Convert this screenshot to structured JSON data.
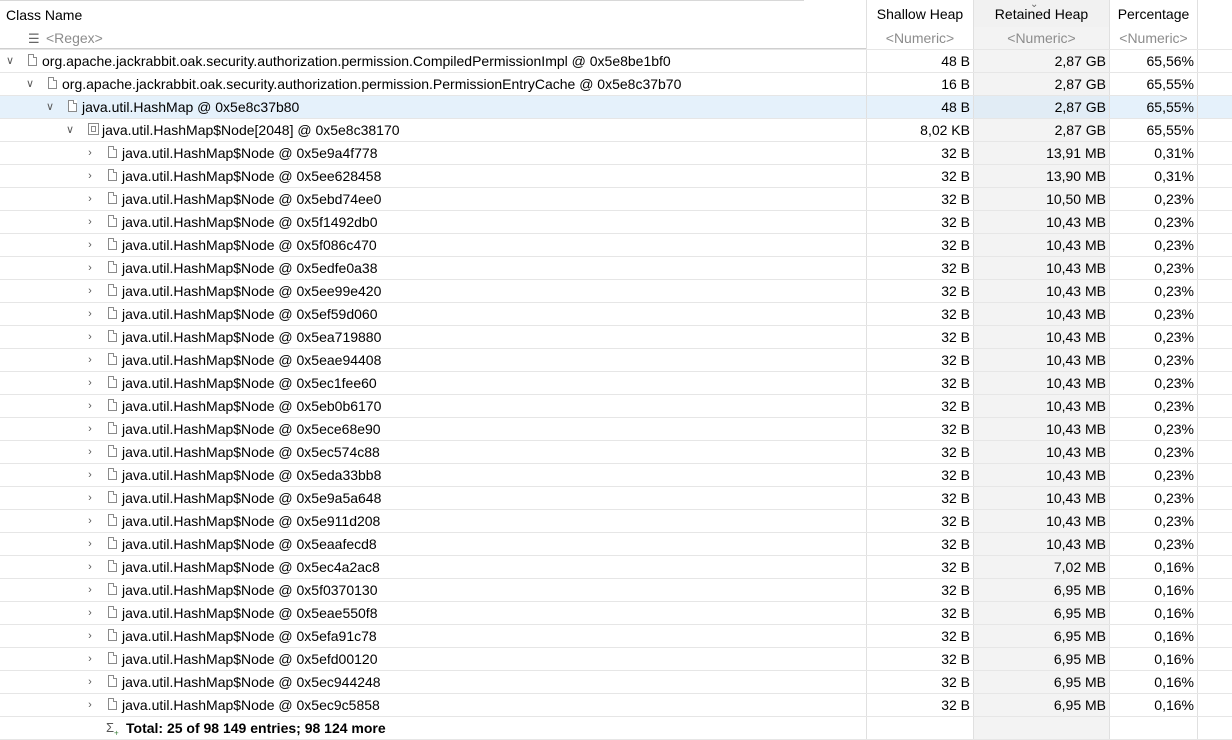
{
  "columns": {
    "name": "Class Name",
    "shallow": "Shallow Heap",
    "retained": "Retained Heap",
    "percentage": "Percentage"
  },
  "filter": {
    "name": "<Regex>",
    "shallow": "<Numeric>",
    "retained": "<Numeric>",
    "percentage": "<Numeric>"
  },
  "rows": [
    {
      "label": "org.apache.jackrabbit.oak.security.authorization.permission.CompiledPermissionImpl @ 0x5e8be1bf0",
      "shallow": "48 B",
      "retained": "2,87 GB",
      "pct": "65,56%"
    },
    {
      "label": "org.apache.jackrabbit.oak.security.authorization.permission.PermissionEntryCache @ 0x5e8c37b70",
      "shallow": "16 B",
      "retained": "2,87 GB",
      "pct": "65,55%"
    },
    {
      "label": "java.util.HashMap @ 0x5e8c37b80",
      "shallow": "48 B",
      "retained": "2,87 GB",
      "pct": "65,55%"
    },
    {
      "label": "java.util.HashMap$Node[2048] @ 0x5e8c38170",
      "shallow": "8,02 KB",
      "retained": "2,87 GB",
      "pct": "65,55%"
    },
    {
      "label": "java.util.HashMap$Node @ 0x5e9a4f778",
      "shallow": "32 B",
      "retained": "13,91 MB",
      "pct": "0,31%"
    },
    {
      "label": "java.util.HashMap$Node @ 0x5ee628458",
      "shallow": "32 B",
      "retained": "13,90 MB",
      "pct": "0,31%"
    },
    {
      "label": "java.util.HashMap$Node @ 0x5ebd74ee0",
      "shallow": "32 B",
      "retained": "10,50 MB",
      "pct": "0,23%"
    },
    {
      "label": "java.util.HashMap$Node @ 0x5f1492db0",
      "shallow": "32 B",
      "retained": "10,43 MB",
      "pct": "0,23%"
    },
    {
      "label": "java.util.HashMap$Node @ 0x5f086c470",
      "shallow": "32 B",
      "retained": "10,43 MB",
      "pct": "0,23%"
    },
    {
      "label": "java.util.HashMap$Node @ 0x5edfe0a38",
      "shallow": "32 B",
      "retained": "10,43 MB",
      "pct": "0,23%"
    },
    {
      "label": "java.util.HashMap$Node @ 0x5ee99e420",
      "shallow": "32 B",
      "retained": "10,43 MB",
      "pct": "0,23%"
    },
    {
      "label": "java.util.HashMap$Node @ 0x5ef59d060",
      "shallow": "32 B",
      "retained": "10,43 MB",
      "pct": "0,23%"
    },
    {
      "label": "java.util.HashMap$Node @ 0x5ea719880",
      "shallow": "32 B",
      "retained": "10,43 MB",
      "pct": "0,23%"
    },
    {
      "label": "java.util.HashMap$Node @ 0x5eae94408",
      "shallow": "32 B",
      "retained": "10,43 MB",
      "pct": "0,23%"
    },
    {
      "label": "java.util.HashMap$Node @ 0x5ec1fee60",
      "shallow": "32 B",
      "retained": "10,43 MB",
      "pct": "0,23%"
    },
    {
      "label": "java.util.HashMap$Node @ 0x5eb0b6170",
      "shallow": "32 B",
      "retained": "10,43 MB",
      "pct": "0,23%"
    },
    {
      "label": "java.util.HashMap$Node @ 0x5ece68e90",
      "shallow": "32 B",
      "retained": "10,43 MB",
      "pct": "0,23%"
    },
    {
      "label": "java.util.HashMap$Node @ 0x5ec574c88",
      "shallow": "32 B",
      "retained": "10,43 MB",
      "pct": "0,23%"
    },
    {
      "label": "java.util.HashMap$Node @ 0x5eda33bb8",
      "shallow": "32 B",
      "retained": "10,43 MB",
      "pct": "0,23%"
    },
    {
      "label": "java.util.HashMap$Node @ 0x5e9a5a648",
      "shallow": "32 B",
      "retained": "10,43 MB",
      "pct": "0,23%"
    },
    {
      "label": "java.util.HashMap$Node @ 0x5e911d208",
      "shallow": "32 B",
      "retained": "10,43 MB",
      "pct": "0,23%"
    },
    {
      "label": "java.util.HashMap$Node @ 0x5eaafecd8",
      "shallow": "32 B",
      "retained": "10,43 MB",
      "pct": "0,23%"
    },
    {
      "label": "java.util.HashMap$Node @ 0x5ec4a2ac8",
      "shallow": "32 B",
      "retained": "7,02 MB",
      "pct": "0,16%"
    },
    {
      "label": "java.util.HashMap$Node @ 0x5f0370130",
      "shallow": "32 B",
      "retained": "6,95 MB",
      "pct": "0,16%"
    },
    {
      "label": "java.util.HashMap$Node @ 0x5eae550f8",
      "shallow": "32 B",
      "retained": "6,95 MB",
      "pct": "0,16%"
    },
    {
      "label": "java.util.HashMap$Node @ 0x5efa91c78",
      "shallow": "32 B",
      "retained": "6,95 MB",
      "pct": "0,16%"
    },
    {
      "label": "java.util.HashMap$Node @ 0x5efd00120",
      "shallow": "32 B",
      "retained": "6,95 MB",
      "pct": "0,16%"
    },
    {
      "label": "java.util.HashMap$Node @ 0x5ec944248",
      "shallow": "32 B",
      "retained": "6,95 MB",
      "pct": "0,16%"
    },
    {
      "label": "java.util.HashMap$Node @ 0x5ec9c5858",
      "shallow": "32 B",
      "retained": "6,95 MB",
      "pct": "0,16%"
    }
  ],
  "total": "Total: 25 of 98 149 entries; 98 124 more",
  "icons": {
    "expanded": "chevron-down-icon",
    "collapsed": "chevron-right-icon",
    "object": "object-icon",
    "array": "array-icon",
    "filter": "filter-icon",
    "total": "sigma-icon"
  },
  "colors": {
    "selection": "#e5f1fb",
    "retained_column": "#f3f3f3",
    "placeholder": "#8c8c8c"
  }
}
